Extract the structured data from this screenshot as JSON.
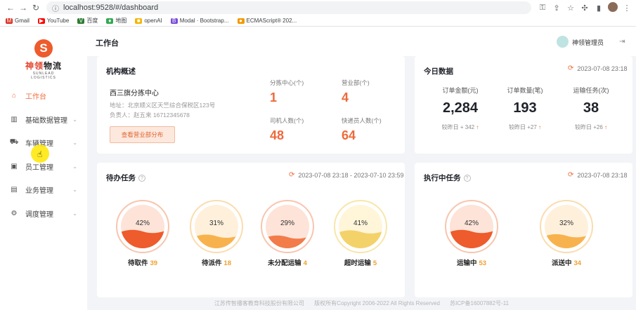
{
  "browser": {
    "url": "localhost:9528/#/dashboard",
    "bookmarks": [
      {
        "label": "Gmail",
        "color": "#d93025",
        "glyph": "M"
      },
      {
        "label": "YouTube",
        "color": "#ff0000",
        "glyph": "▶"
      },
      {
        "label": "百度",
        "color": "#2e7d32",
        "glyph": "V"
      },
      {
        "label": "地图",
        "color": "#34a853",
        "glyph": "♦"
      },
      {
        "label": "openAI",
        "color": "#f4b400",
        "glyph": "■"
      },
      {
        "label": "Modal · Bootstrap...",
        "color": "#7b4bd6",
        "glyph": "B"
      },
      {
        "label": "ECMAScript® 202...",
        "color": "#f29900",
        "glyph": "●"
      }
    ]
  },
  "brand": {
    "name_a": "神领",
    "name_b": "物流",
    "sub": "SUNLEAD LOGISTICS",
    "mark": "S",
    "color": "#ee5b2c"
  },
  "sidebar": {
    "items": [
      {
        "label": "工作台",
        "icon": "home-icon",
        "glyph": "⌂",
        "active": true,
        "chevron": false
      },
      {
        "label": "基础数据管理",
        "icon": "chart-icon",
        "glyph": "▥",
        "active": false,
        "chevron": true
      },
      {
        "label": "车辆管理",
        "icon": "truck-icon",
        "glyph": "⛟",
        "active": false,
        "chevron": true
      },
      {
        "label": "员工管理",
        "icon": "staff-icon",
        "glyph": "▣",
        "active": false,
        "chevron": true
      },
      {
        "label": "业务管理",
        "icon": "business-icon",
        "glyph": "▤",
        "active": false,
        "chevron": true
      },
      {
        "label": "调度管理",
        "icon": "dispatch-icon",
        "glyph": "⚙",
        "active": false,
        "chevron": true
      }
    ]
  },
  "header": {
    "title": "工作台",
    "user": "神领管理员"
  },
  "institution": {
    "title": "机构概述",
    "name": "西三旗分拣中心",
    "address_label": "地址：",
    "address": "北京顺义区天竺综合保税区123号",
    "contact_label": "负责人：",
    "contact": "赵五来 16712345678",
    "button": "查看营业部分布",
    "stats": [
      {
        "label": "分拣中心(个)",
        "value": "1"
      },
      {
        "label": "营业部(个)",
        "value": "4"
      },
      {
        "label": "司机人数(个)",
        "value": "48"
      },
      {
        "label": "快递员人数(个)",
        "value": "64"
      }
    ]
  },
  "today": {
    "title": "今日数据",
    "time": "2023-07-08 23:18",
    "items": [
      {
        "label": "订单金额(元)",
        "value": "2,284",
        "compare": "较昨日 + 342"
      },
      {
        "label": "订单数量(笔)",
        "value": "193",
        "compare": "较昨日 +27"
      },
      {
        "label": "运输任务(次)",
        "value": "38",
        "compare": "较昨日 +26"
      }
    ]
  },
  "todo": {
    "title": "待办任务",
    "time": "2023-07-08 23:18 - 2023-07-10 23:59",
    "rings": [
      {
        "label": "待取件",
        "count": "39",
        "percent": 42,
        "percent_text": "42%",
        "bg": "#fde3d8",
        "fill": "#ee5b2c",
        "ring": "#f8c5ae"
      },
      {
        "label": "待派件",
        "count": "18",
        "percent": 31,
        "percent_text": "31%",
        "bg": "#fff0dc",
        "fill": "#f8b24d",
        "ring": "#fbdcae"
      },
      {
        "label": "未分配运输",
        "count": "4",
        "percent": 29,
        "percent_text": "29%",
        "bg": "#fde3d8",
        "fill": "#f27c4a",
        "ring": "#f8c5ae"
      },
      {
        "label": "超时运输",
        "count": "5",
        "percent": 41,
        "percent_text": "41%",
        "bg": "#fff5d9",
        "fill": "#f4d26a",
        "ring": "#f8e6a9"
      }
    ]
  },
  "running": {
    "title": "执行中任务",
    "time": "2023-07-08 23:18",
    "rings": [
      {
        "label": "运输中",
        "count": "53",
        "percent": 42,
        "percent_text": "42%",
        "bg": "#fde3d8",
        "fill": "#ee5b2c",
        "ring": "#f8c5ae"
      },
      {
        "label": "派送中",
        "count": "34",
        "percent": 32,
        "percent_text": "32%",
        "bg": "#fff0dc",
        "fill": "#f8b24d",
        "ring": "#fbdcae"
      }
    ]
  },
  "footer": {
    "company": "江苏传智播客教育科技股份有限公司",
    "copyright": "版权所有Copyright 2006-2022 All Rights Reserved",
    "icp": "苏ICP备16007882号-11"
  },
  "colors": {
    "accent": "#ee6a3a",
    "count": "#f0a030"
  }
}
